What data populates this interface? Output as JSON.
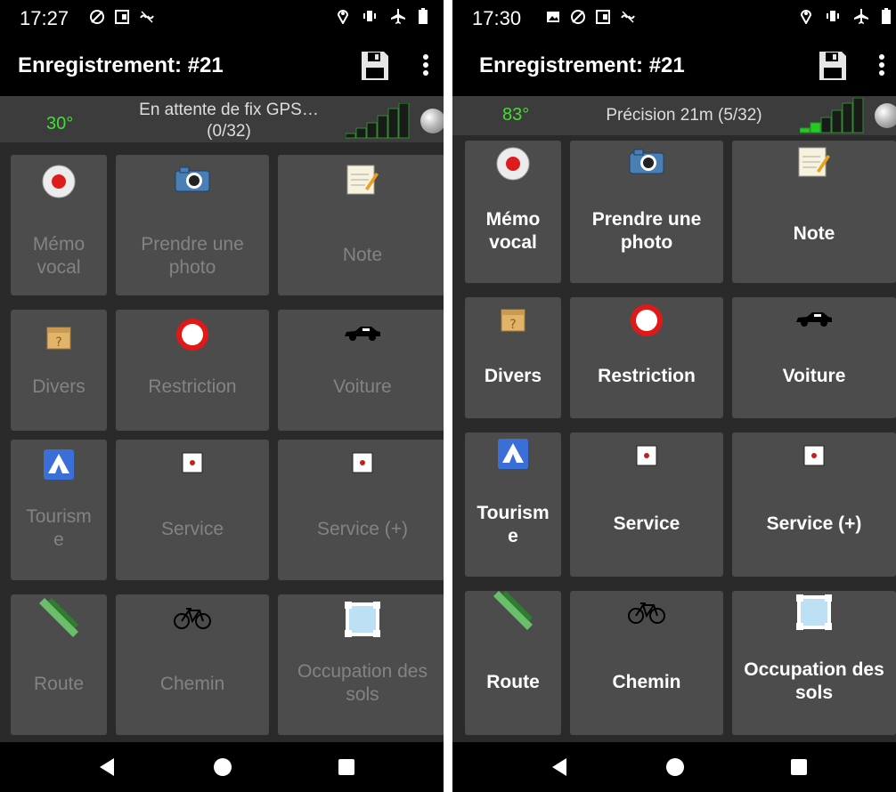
{
  "left": {
    "status": {
      "time": "17:27"
    },
    "appbar": {
      "title": "Enregistrement: #21"
    },
    "gps": {
      "angle": "30°",
      "status_line1": "En attente de fix GPS…",
      "status_line2": "(0/32)",
      "signal_bars_filled": 0
    },
    "tiles": [
      {
        "line1": "Mémo",
        "line2": "vocal",
        "icon": "record-icon"
      },
      {
        "line1": "Prendre une",
        "line2": "photo",
        "icon": "camera-icon"
      },
      {
        "line1": "Note",
        "line2": "",
        "icon": "notepad-icon"
      },
      {
        "line1": "Divers",
        "line2": "",
        "icon": "mystery-box-icon"
      },
      {
        "line1": "Restriction",
        "line2": "",
        "icon": "no-entry-sign-icon"
      },
      {
        "line1": "Voiture",
        "line2": "",
        "icon": "car-icon"
      },
      {
        "line1": "Tourism",
        "line2": "e",
        "icon": "campsite-icon"
      },
      {
        "line1": "Service",
        "line2": "",
        "icon": "service-marker-icon"
      },
      {
        "line1": "Service (+)",
        "line2": "",
        "icon": "service-marker-icon"
      },
      {
        "line1": "Route",
        "line2": "",
        "icon": "road-icon"
      },
      {
        "line1": "Chemin",
        "line2": "",
        "icon": "bicycle-icon"
      },
      {
        "line1": "Occupation des",
        "line2": "sols",
        "icon": "landuse-frame-icon"
      }
    ]
  },
  "right": {
    "status": {
      "time": "17:30"
    },
    "appbar": {
      "title": "Enregistrement: #21"
    },
    "gps": {
      "angle": "83°",
      "status_line1": "Précision 21m (5/32)",
      "status_line2": "",
      "signal_bars_filled": 2
    },
    "tiles": [
      {
        "line1": "Mémo",
        "line2": "vocal",
        "icon": "record-icon"
      },
      {
        "line1": "Prendre une",
        "line2": "photo",
        "icon": "camera-icon"
      },
      {
        "line1": "Note",
        "line2": "",
        "icon": "notepad-icon"
      },
      {
        "line1": "Divers",
        "line2": "",
        "icon": "mystery-box-icon"
      },
      {
        "line1": "Restriction",
        "line2": "",
        "icon": "no-entry-sign-icon"
      },
      {
        "line1": "Voiture",
        "line2": "",
        "icon": "car-icon"
      },
      {
        "line1": "Tourism",
        "line2": "e",
        "icon": "campsite-icon"
      },
      {
        "line1": "Service",
        "line2": "",
        "icon": "service-marker-icon"
      },
      {
        "line1": "Service (+)",
        "line2": "",
        "icon": "service-marker-icon"
      },
      {
        "line1": "Route",
        "line2": "",
        "icon": "road-icon"
      },
      {
        "line1": "Chemin",
        "line2": "",
        "icon": "bicycle-icon"
      },
      {
        "line1": "Occupation des",
        "line2": "sols",
        "icon": "landuse-frame-icon"
      }
    ]
  },
  "colors": {
    "gps_angle": "#44dd33",
    "tile_bg": "#4c4c4c",
    "grid_bg": "#2a2a2a",
    "gps_bar_bg": "#3c3c3c",
    "label_disabled": "#838383",
    "label_enabled": "#ffffff"
  }
}
